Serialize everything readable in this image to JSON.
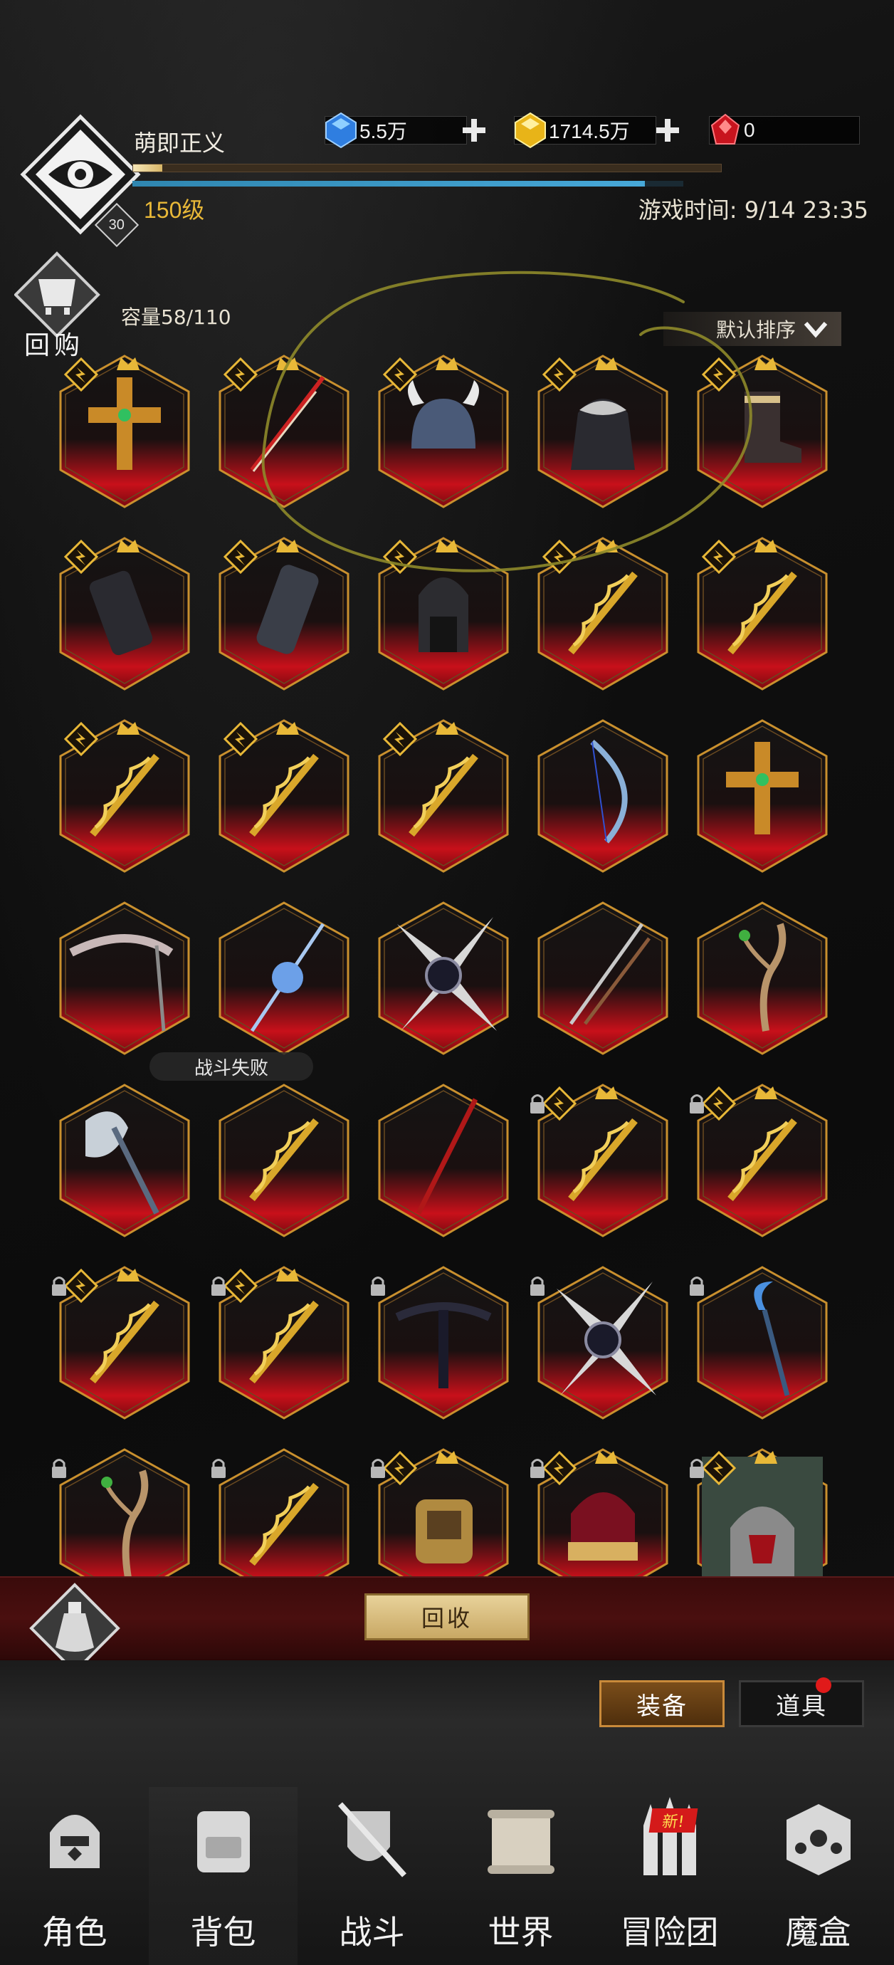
{
  "player": {
    "name": "萌即正义",
    "level_text": "150级",
    "badge_number": "30",
    "xp_fraction": 0.05,
    "mp_fraction": 0.93
  },
  "currencies": [
    {
      "name": "blue-gem",
      "value": "5.5万",
      "color": "#3aa0ff"
    },
    {
      "name": "gold-gem",
      "value": "1714.5万",
      "color": "#f2c21a"
    },
    {
      "name": "red-gem",
      "value": "0",
      "color": "#d41a2a"
    }
  ],
  "game_time": "游戏时间: 9/14 23:35",
  "inventory": {
    "buyback_label": "回购",
    "capacity": "容量58/110",
    "sort_label": "默认排序",
    "items": [
      {
        "icon": "golden-cross-icon",
        "rarity_tag": true,
        "lock": false
      },
      {
        "icon": "spear-icon",
        "rarity_tag": true,
        "lock": false
      },
      {
        "icon": "horned-helmet-icon",
        "rarity_tag": true,
        "lock": false
      },
      {
        "icon": "hooded-cloak-icon",
        "rarity_tag": true,
        "lock": false
      },
      {
        "icon": "boot-icon",
        "rarity_tag": true,
        "lock": false
      },
      {
        "icon": "bracer-icon",
        "rarity_tag": true,
        "lock": false
      },
      {
        "icon": "gauntlet-icon",
        "rarity_tag": true,
        "lock": false
      },
      {
        "icon": "hood-icon",
        "rarity_tag": true,
        "lock": false
      },
      {
        "icon": "golden-staff-icon",
        "rarity_tag": true,
        "lock": false
      },
      {
        "icon": "golden-staff-icon",
        "rarity_tag": true,
        "lock": false
      },
      {
        "icon": "golden-staff-icon",
        "rarity_tag": true,
        "lock": false
      },
      {
        "icon": "golden-staff-icon",
        "rarity_tag": true,
        "lock": false
      },
      {
        "icon": "golden-staff-icon",
        "rarity_tag": true,
        "lock": false
      },
      {
        "icon": "thorn-bow-icon",
        "rarity_tag": false,
        "lock": false
      },
      {
        "icon": "golden-cross-icon",
        "rarity_tag": false,
        "lock": false
      },
      {
        "icon": "bone-scythe-icon",
        "rarity_tag": false,
        "lock": false
      },
      {
        "icon": "ice-spear-icon",
        "rarity_tag": false,
        "lock": false
      },
      {
        "icon": "shuriken-icon",
        "rarity_tag": false,
        "lock": false
      },
      {
        "icon": "twin-staff-icon",
        "rarity_tag": false,
        "lock": false
      },
      {
        "icon": "branch-staff-icon",
        "rarity_tag": false,
        "lock": false
      },
      {
        "icon": "battle-axe-icon",
        "rarity_tag": false,
        "lock": false
      },
      {
        "icon": "golden-staff-icon",
        "rarity_tag": false,
        "lock": false
      },
      {
        "icon": "red-spear-icon",
        "rarity_tag": false,
        "lock": false
      },
      {
        "icon": "golden-staff-icon",
        "rarity_tag": true,
        "lock": true
      },
      {
        "icon": "golden-staff-icon",
        "rarity_tag": true,
        "lock": true
      },
      {
        "icon": "golden-staff-icon",
        "rarity_tag": true,
        "lock": true
      },
      {
        "icon": "golden-staff-icon",
        "rarity_tag": true,
        "lock": true
      },
      {
        "icon": "dark-crossbow-icon",
        "rarity_tag": false,
        "lock": true
      },
      {
        "icon": "shuriken-icon",
        "rarity_tag": false,
        "lock": true
      },
      {
        "icon": "crescent-staff-icon",
        "rarity_tag": false,
        "lock": true
      },
      {
        "icon": "branch-staff-icon",
        "rarity_tag": false,
        "lock": true
      },
      {
        "icon": "golden-staff-icon",
        "rarity_tag": false,
        "lock": true
      },
      {
        "icon": "ring-icon",
        "rarity_tag": true,
        "lock": true
      },
      {
        "icon": "crown-icon",
        "rarity_tag": true,
        "lock": true
      },
      {
        "icon": "armor-portrait-icon",
        "rarity_tag": true,
        "lock": true
      }
    ]
  },
  "toast": "战斗失败",
  "recycle_label": "回收",
  "tabs": {
    "equip": "装备",
    "items": "道具"
  },
  "nav": [
    {
      "label": "角色",
      "icon": "helmet-icon",
      "active": false
    },
    {
      "label": "背包",
      "icon": "backpack-icon",
      "active": true
    },
    {
      "label": "战斗",
      "icon": "shield-sword-icon",
      "active": false
    },
    {
      "label": "世界",
      "icon": "map-scroll-icon",
      "active": false
    },
    {
      "label": "冒险团",
      "icon": "castle-icon",
      "active": false,
      "badge": "新!"
    },
    {
      "label": "魔盒",
      "icon": "magic-cube-icon",
      "active": false
    }
  ],
  "colors": {
    "frame_gold": "#c9902e",
    "frame_red": "#c8101a",
    "accent": "#e8b838"
  }
}
